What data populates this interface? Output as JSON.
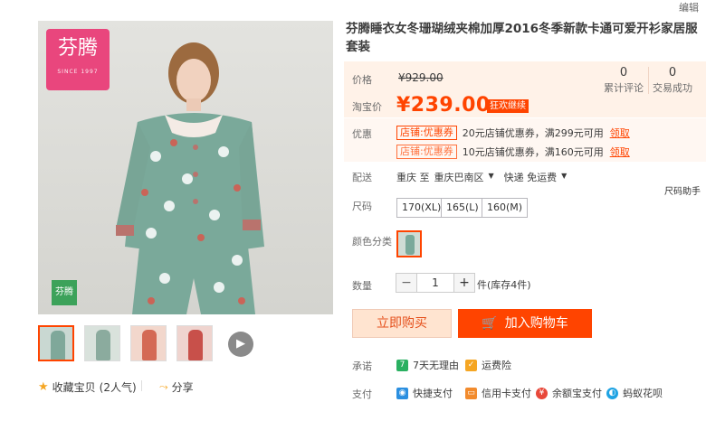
{
  "top_right": {
    "edit_label": "编辑"
  },
  "gallery": {
    "brand_logo": {
      "text": "芬腾",
      "sub": "SINCE 1997"
    },
    "small_logo": "芬腾",
    "thumbs": [
      {
        "color": "#c9d8d2",
        "fig": "#7fa89a"
      },
      {
        "color": "#d9e2dc",
        "fig": "#8bab9e"
      },
      {
        "color": "#f2d7cc",
        "fig": "#d46a55"
      },
      {
        "color": "#efd4cf",
        "fig": "#c8504a"
      }
    ],
    "play_icon": "play-icon"
  },
  "actions": {
    "favorite_label": "收藏宝贝",
    "favorite_count": "(2人气)",
    "share_label": "分享"
  },
  "product": {
    "title": "芬腾睡衣女冬珊瑚绒夹棉加厚2016冬季新款卡通可爱开衫家居服套装",
    "price_label": "价格",
    "original_price": "¥929.00",
    "taobao_price_label": "淘宝价",
    "price": "¥239.00",
    "promo_tag": "狂欢继续",
    "reviews_count": "0",
    "reviews_label": "累计评论",
    "sales_count": "0",
    "sales_label": "交易成功",
    "discount_label": "优惠",
    "coupons": [
      {
        "tag": "店铺:优惠券",
        "text": "20元店铺优惠券，满299元可用",
        "link": "领取"
      },
      {
        "tag": "店铺:优惠券",
        "text": "10元店铺优惠券，满160元可用",
        "link": "领取"
      }
    ],
    "shipping_label": "配送",
    "shipping_from": "重庆 至",
    "shipping_to": "重庆巴南区",
    "shipping_method": "快递 免运费",
    "size_helper": "尺码助手",
    "size_label": "尺码",
    "sizes": [
      "170(XL)",
      "165(L)",
      "160(M)"
    ],
    "color_label": "颜色分类",
    "qty_label": "数量",
    "qty_minus": "−",
    "qty_value": "1",
    "qty_plus": "+",
    "stock": "件(库存4件)",
    "buy_now": "立即购买",
    "add_to_cart": "加入购物车",
    "promise_label": "承诺",
    "promises": [
      {
        "icon": "7",
        "text": "7天无理由",
        "color": "#2ab061"
      },
      {
        "icon": "✓",
        "text": "运费险",
        "color": "#f5a623"
      }
    ],
    "payment_label": "支付",
    "payments": [
      {
        "text": "快捷支付",
        "color": "#2b8fe0"
      },
      {
        "text": "信用卡支付",
        "color": "#f28b2d"
      },
      {
        "text": "余额宝支付",
        "color": "#e8483a"
      },
      {
        "text": "蚂蚁花呗",
        "color": "#1fa3e3"
      }
    ]
  },
  "colors": {
    "accent": "#ff4400",
    "price_bg": "#fff2e8"
  }
}
